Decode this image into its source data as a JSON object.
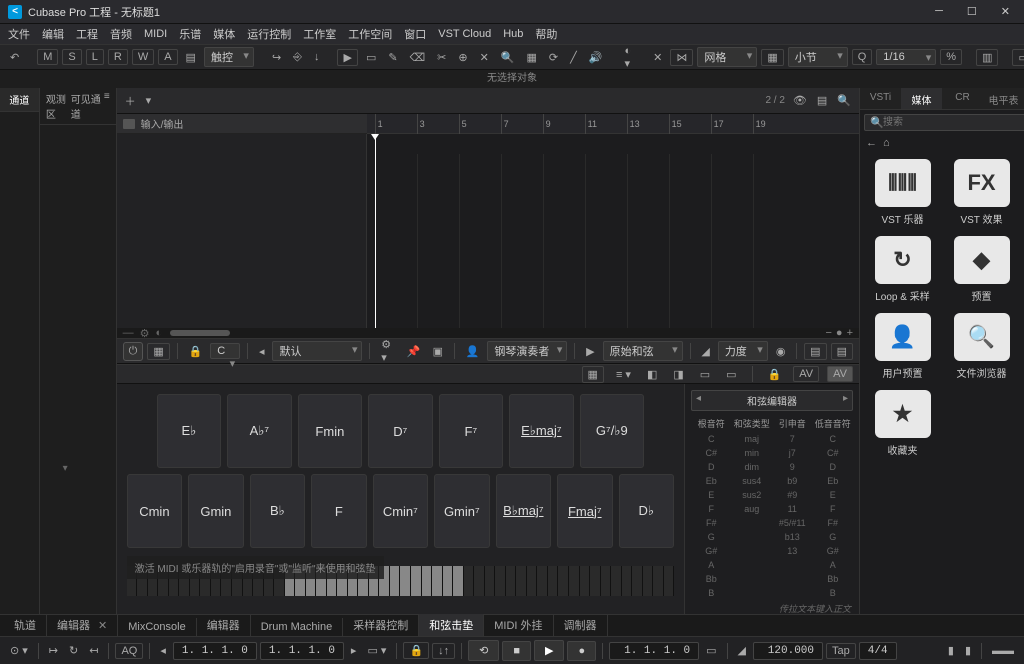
{
  "window": {
    "title": "Cubase Pro 工程 - 无标题1"
  },
  "menus": [
    "文件",
    "编辑",
    "工程",
    "音频",
    "MIDI",
    "乐谱",
    "媒体",
    "运行控制",
    "工作室",
    "工作空间",
    "窗口",
    "VST Cloud",
    "Hub",
    "帮助"
  ],
  "toolbar": {
    "touch": "触控",
    "grid": "网格",
    "bar": "小节",
    "quant": "1/16"
  },
  "status": "无选择对象",
  "left_tabs": {
    "channel": "通道",
    "viewport": "观测区",
    "visibility": "可见通道",
    "eq": "≡"
  },
  "track_header": {
    "count": "2 / 2",
    "io": "输入/输出"
  },
  "ruler": [
    "1",
    "3",
    "5",
    "7",
    "9",
    "11",
    "13",
    "15",
    "17",
    "19"
  ],
  "editor_bar": {
    "key": "C",
    "preset": "默认",
    "player": "钢琴演奏者",
    "chords": "原始和弦",
    "velocity": "力度"
  },
  "chord_row1": [
    "E♭",
    "A♭⁷",
    "Fmin",
    "D⁷",
    "F⁷",
    "E♭maj⁷",
    "G⁷/♭9"
  ],
  "chord_row2": [
    "Cmin",
    "Gmin",
    "B♭",
    "F",
    "Cmin⁷",
    "Gmin⁷",
    "B♭maj⁷",
    "Fmaj⁷",
    "D♭"
  ],
  "activate": "激活 MIDI 或乐器轨的\"启用录音\"或\"监听\"来使用和弦垫",
  "chord_table": {
    "title": "和弦编辑器",
    "headers": [
      "根音符",
      "和弦类型",
      "引申音",
      "低音音符"
    ],
    "roots": [
      "C",
      "C#",
      "D",
      "Eb",
      "E",
      "F",
      "F#",
      "G",
      "G#",
      "A",
      "Bb",
      "B"
    ],
    "types": [
      "maj",
      "min",
      "dim",
      "sus4",
      "sus2",
      "aug"
    ],
    "tens": [
      "7",
      "j7",
      "9",
      "b9",
      "#9",
      "11",
      "#5/#11",
      "b13",
      "13"
    ],
    "bass": [
      "C",
      "C#",
      "D",
      "Eb",
      "E",
      "F",
      "F#",
      "G",
      "G#",
      "A",
      "Bb",
      "B"
    ],
    "footer": "传拉文本键入正文"
  },
  "right": {
    "tabs": [
      "VSTi",
      "媒体",
      "CR",
      "电平表"
    ],
    "search_ph": "搜索",
    "items": [
      {
        "label": "VST 乐器",
        "icon": "inst"
      },
      {
        "label": "VST 效果",
        "icon": "fx"
      },
      {
        "label": "Loop & 采样",
        "icon": "loop"
      },
      {
        "label": "预置",
        "icon": "preset"
      },
      {
        "label": "用户预置",
        "icon": "user"
      },
      {
        "label": "文件浏览器",
        "icon": "file"
      },
      {
        "label": "收藏夹",
        "icon": "star"
      }
    ]
  },
  "bottom_tabs": {
    "tracks": "轨道",
    "editor": "编辑器",
    "mix": "MixConsole",
    "edit2": "编辑器",
    "drum": "Drum Machine",
    "sampler": "采样器控制",
    "chordpad": "和弦击垫",
    "midi": "MIDI 外挂",
    "modulator": "调制器"
  },
  "transport": {
    "aq": "AQ",
    "pos1": "1. 1. 1.  0",
    "pos2": "1. 1. 1.  0",
    "tempo": "120.000",
    "tap": "Tap",
    "sig": "4/4"
  }
}
